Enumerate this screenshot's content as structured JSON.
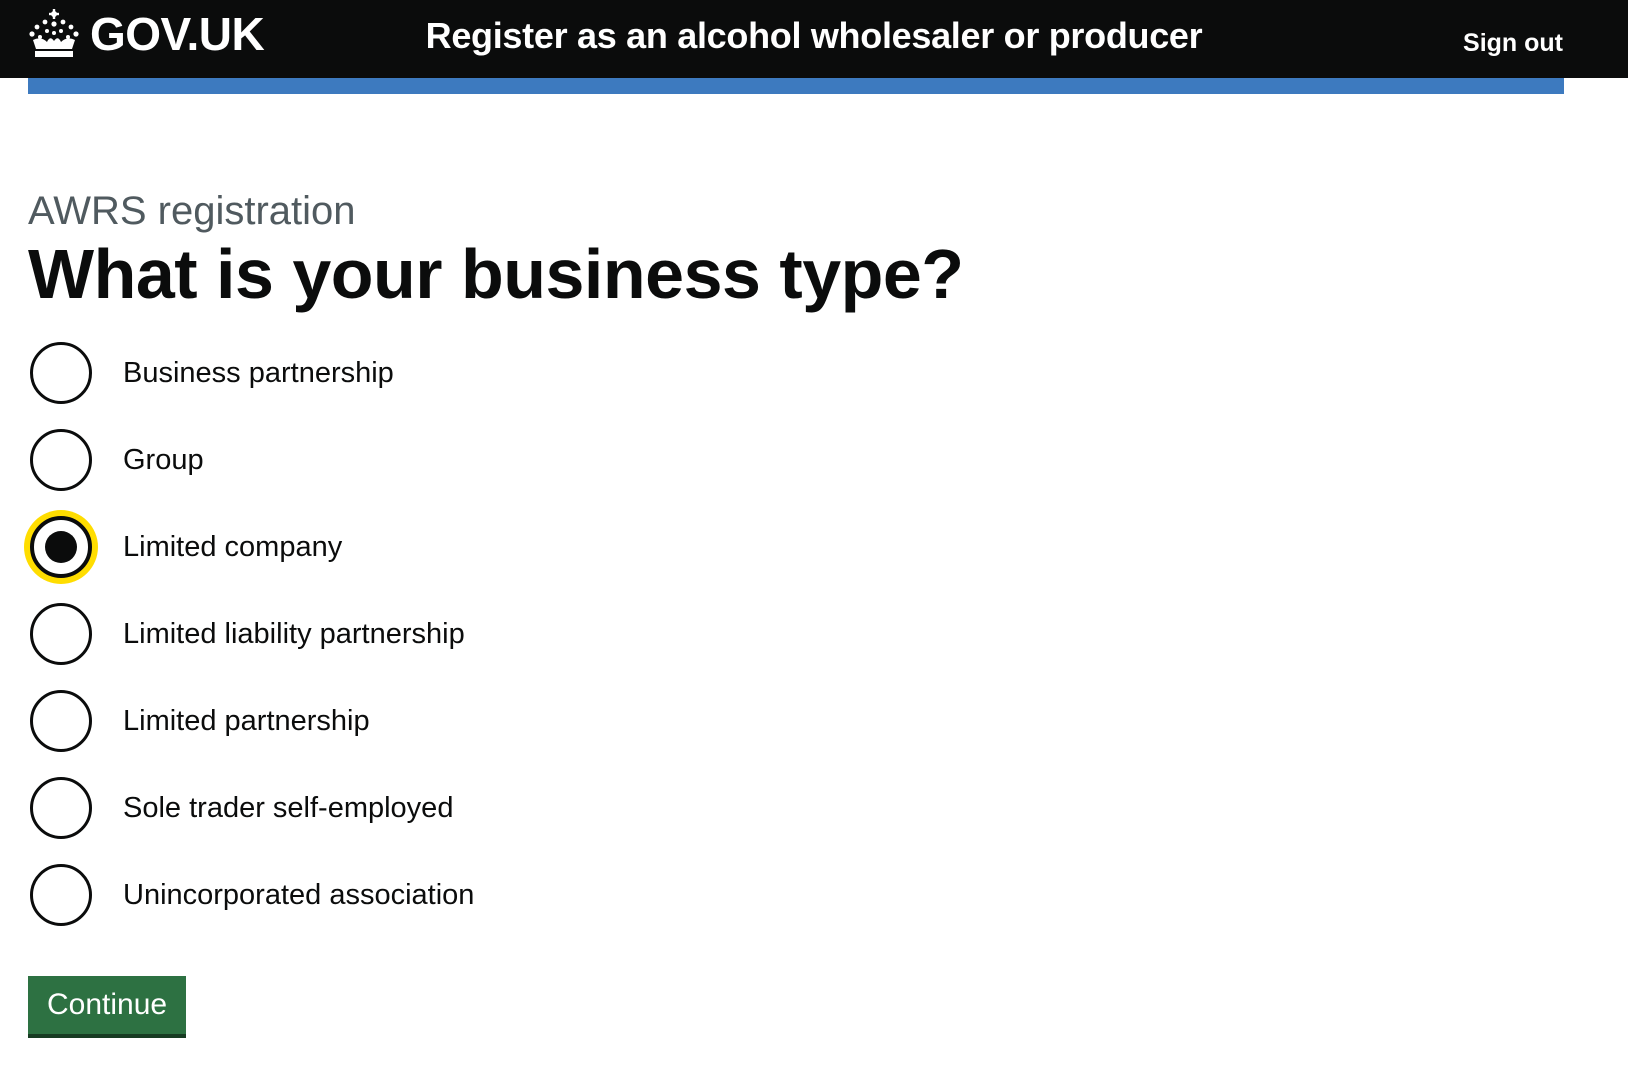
{
  "header": {
    "logo_text": "GOV.UK",
    "logo_icon": "crown-icon",
    "service_name": "Register as an alcohol wholesaler or producer",
    "sign_out": "Sign out"
  },
  "colors": {
    "header_bg": "#0b0c0c",
    "accent_bar": "#3d7abf",
    "focus": "#ffdd00",
    "button": "#2d7142",
    "caption": "#505a5f"
  },
  "main": {
    "caption": "AWRS registration",
    "heading": "What is your business type?",
    "options": [
      {
        "label": "Business partnership",
        "checked": false
      },
      {
        "label": "Group",
        "checked": false
      },
      {
        "label": "Limited company",
        "checked": true
      },
      {
        "label": "Limited liability partnership",
        "checked": false
      },
      {
        "label": "Limited partnership",
        "checked": false
      },
      {
        "label": "Sole trader self-employed",
        "checked": false
      },
      {
        "label": "Unincorporated association",
        "checked": false
      }
    ],
    "continue_label": "Continue"
  }
}
